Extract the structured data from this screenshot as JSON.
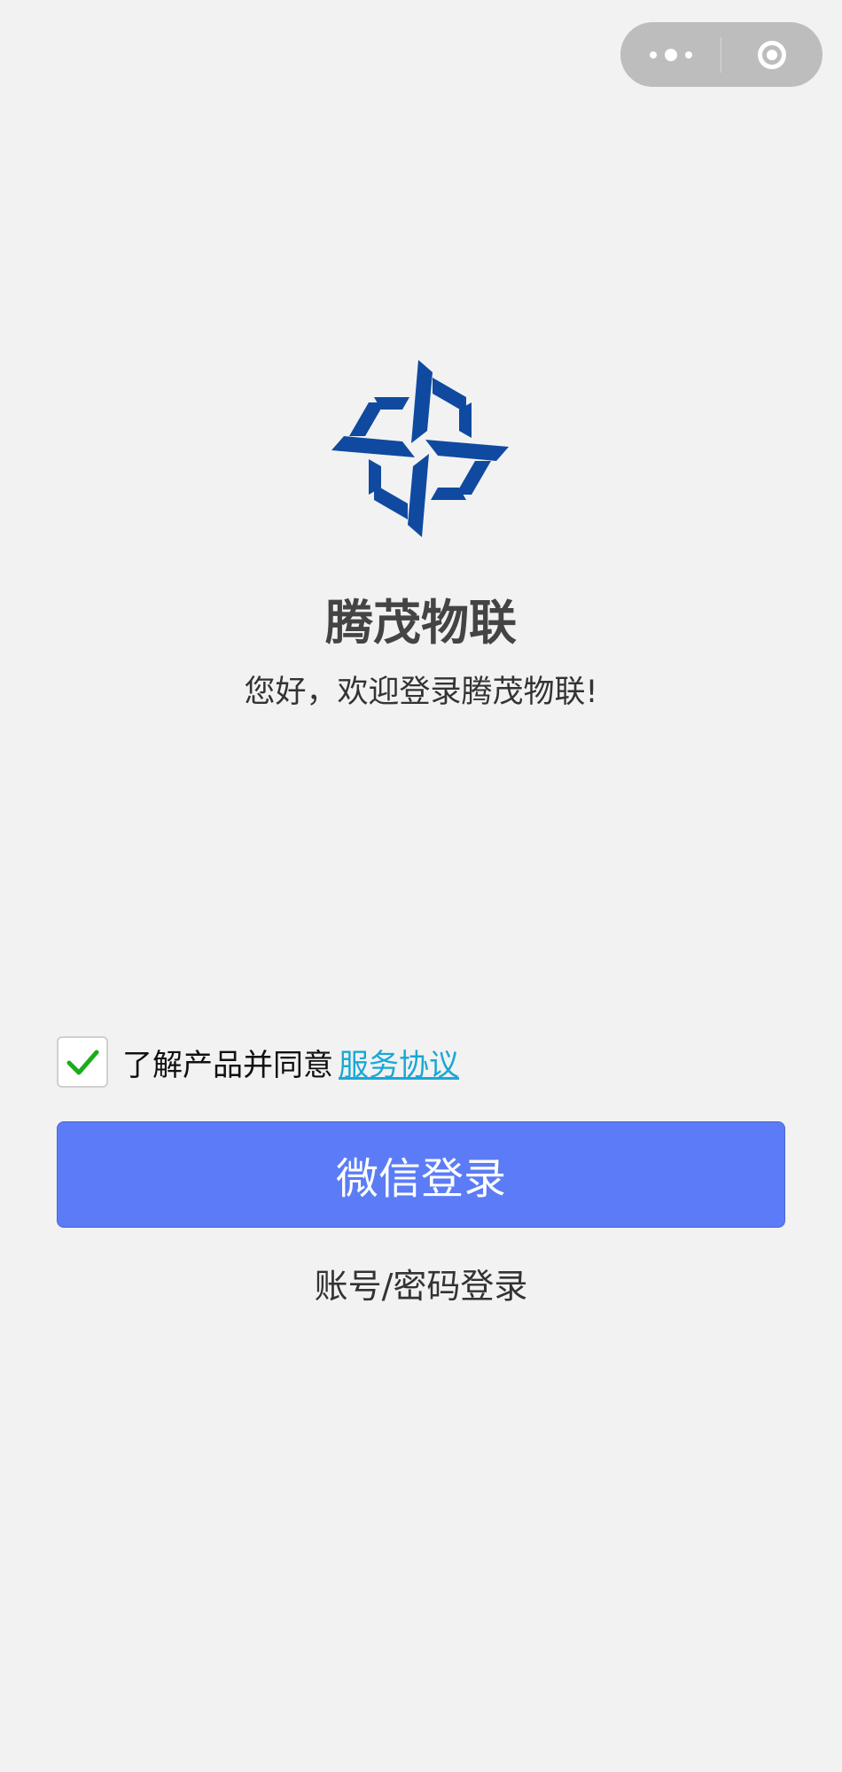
{
  "capsule": {
    "more_icon": "more-dots-icon",
    "close_icon": "target-circle-icon"
  },
  "brand": {
    "logo_icon": "pinwheel-logo",
    "logo_color": "#0f4aa0",
    "name": "腾茂物联",
    "welcome": "您好，欢迎登录腾茂物联!"
  },
  "agreement": {
    "checked": true,
    "text": "了解产品并同意",
    "link": "服务协议",
    "check_color": "#1aad19",
    "link_color": "#1aa7d6"
  },
  "actions": {
    "wechat_login": "微信登录",
    "account_login": "账号/密码登录",
    "primary_color": "#5b7cf6"
  }
}
